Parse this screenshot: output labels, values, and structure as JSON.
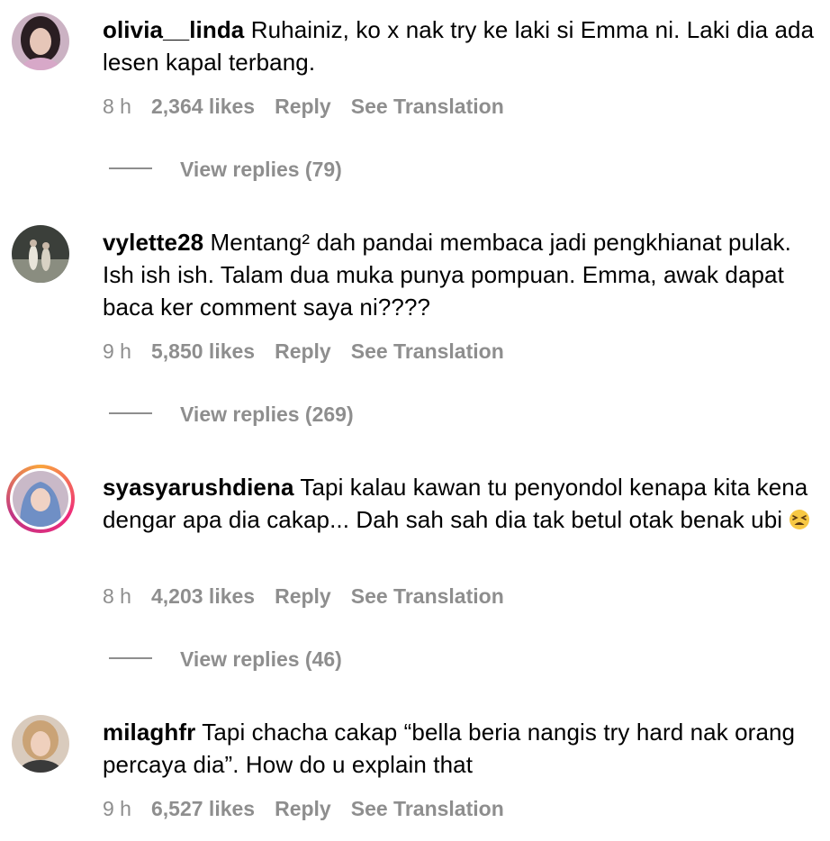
{
  "comments": [
    {
      "username": "olivia__linda",
      "text": "Ruhainiz, ko x nak try ke laki si Emma ni. Laki dia ada lesen kapal terbang.",
      "time": "8 h",
      "likes": "2,364 likes",
      "reply": "Reply",
      "translate": "See Translation",
      "view_replies": "View replies (79)"
    },
    {
      "username": "vylette28",
      "text": "Mentang² dah pandai membaca jadi pengkhianat pulak. Ish ish ish. Talam dua muka punya pompuan. Emma, awak dapat baca ker comment saya ni????",
      "time": "9 h",
      "likes": "5,850 likes",
      "reply": "Reply",
      "translate": "See Translation",
      "view_replies": "View replies (269)"
    },
    {
      "username": "syasyarushdiena",
      "text": "Tapi kalau kawan tu penyondol kenapa kita kena dengar apa dia cakap... Dah sah sah dia tak betul otak benak ubi",
      "emoji": "tired-face-emoji",
      "time": "8 h",
      "likes": "4,203 likes",
      "reply": "Reply",
      "translate": "See Translation",
      "view_replies": "View replies (46)"
    },
    {
      "username": "milaghfr",
      "text": "Tapi chacha cakap “bella beria nangis try hard nak orang percaya dia”. How do u explain that",
      "time": "9 h",
      "likes": "6,527 likes",
      "reply": "Reply",
      "translate": "See Translation"
    }
  ],
  "colors": {
    "meta_text": "#8e8e8e",
    "story_ring": [
      "#f9a53c",
      "#ee2a7b",
      "#c13584"
    ]
  }
}
